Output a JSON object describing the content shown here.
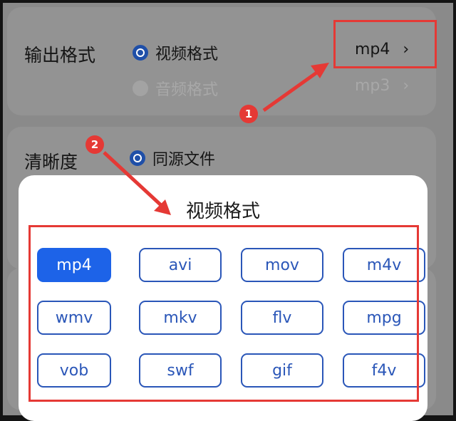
{
  "output_format": {
    "label": "输出格式",
    "options": [
      {
        "label": "视频格式",
        "value": "mp4",
        "selected": true
      },
      {
        "label": "音频格式",
        "value": "mp3",
        "selected": false
      }
    ],
    "chevron": "›"
  },
  "clarity": {
    "label": "清晰度",
    "option": {
      "label": "同源文件",
      "selected": true
    }
  },
  "sheet": {
    "title": "视频格式",
    "formats": [
      "mp4",
      "avi",
      "mov",
      "m4v",
      "wmv",
      "mkv",
      "flv",
      "mpg",
      "vob",
      "swf",
      "gif",
      "f4v"
    ],
    "selected": "mp4"
  },
  "annotations": {
    "marker1": "1",
    "marker2": "2",
    "color": "#e53935"
  },
  "colors": {
    "accent": "#1d63e8",
    "radio": "#1f4fa8",
    "outline": "#2a56b8"
  }
}
